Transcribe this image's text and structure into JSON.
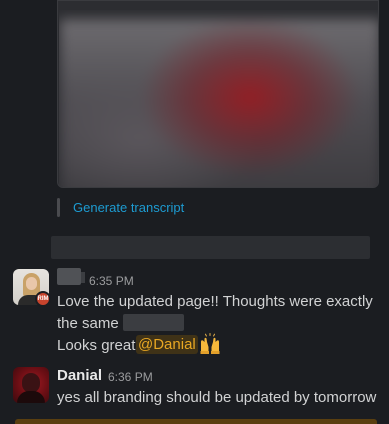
{
  "attachment": {
    "transcript_link": "Generate transcript"
  },
  "messages": [
    {
      "time": "6:35 PM",
      "badge_initials": "RIM",
      "line1": "Love the updated page!! Thoughts were exactly",
      "line2_prefix": "the same",
      "line3_prefix": "Looks great",
      "mention": "@Danial",
      "emoji": "raised-hands"
    },
    {
      "sender": "Danial",
      "time": "6:36 PM",
      "text": "yes all branding should be updated by tomorrow"
    }
  ],
  "colors": {
    "background": "#1b1d21",
    "link": "#1d9bd1",
    "mention_text": "#e8a723",
    "mention_bg": "#3f3217",
    "status_badge": "#c8442d"
  }
}
